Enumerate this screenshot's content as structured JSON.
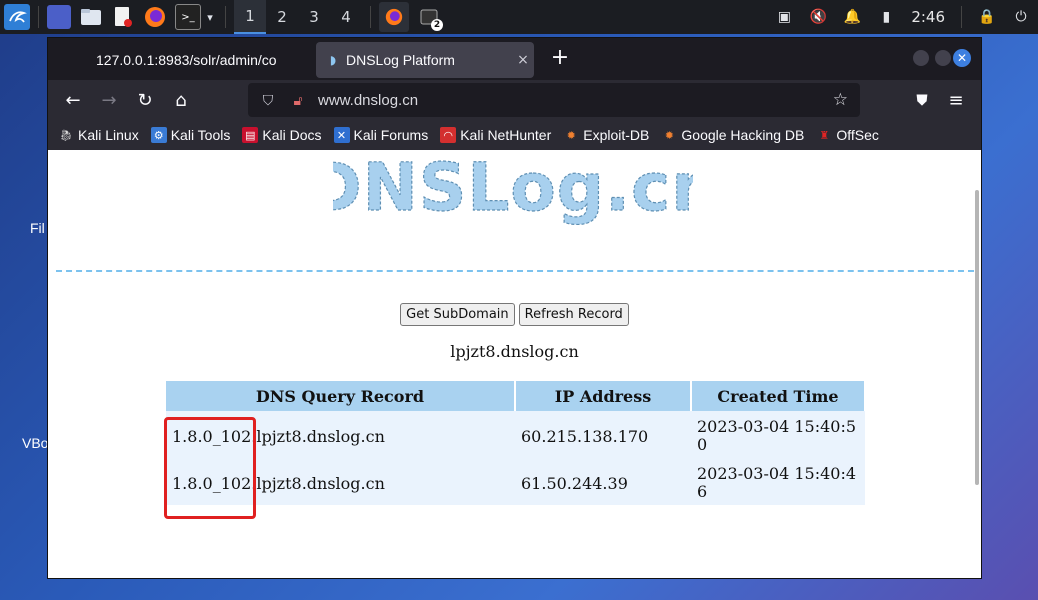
{
  "taskbar": {
    "workspaces": [
      "1",
      "2",
      "3",
      "4"
    ],
    "clock": "2:46",
    "terminal_badge": "2"
  },
  "desktop": {
    "labels": [
      "Fil",
      "VBo"
    ]
  },
  "browser": {
    "tabs": [
      {
        "title": "127.0.0.1:8983/solr/admin/co",
        "close": "×"
      },
      {
        "title": "DNSLog Platform",
        "close": "×"
      }
    ],
    "new_tab": "+",
    "url": "www.dnslog.cn",
    "bookmarks": [
      {
        "label": "Kali Linux",
        "icon": "kali-dragon-icon"
      },
      {
        "label": "Kali Tools",
        "icon": "kali-tools-icon"
      },
      {
        "label": "Kali Docs",
        "icon": "kali-docs-icon"
      },
      {
        "label": "Kali Forums",
        "icon": "kali-forums-icon"
      },
      {
        "label": "Kali NetHunter",
        "icon": "nethunter-icon"
      },
      {
        "label": "Exploit-DB",
        "icon": "exploitdb-icon"
      },
      {
        "label": "Google Hacking DB",
        "icon": "ghdb-icon"
      },
      {
        "label": "OffSec",
        "icon": "offsec-icon"
      }
    ]
  },
  "page": {
    "logo_text": "DNSLog.cn",
    "buttons": {
      "get_subdomain": "Get SubDomain",
      "refresh": "Refresh Record"
    },
    "subdomain": "lpjzt8.dnslog.cn",
    "table": {
      "headers": [
        "DNS Query Record",
        "IP Address",
        "Created Time"
      ],
      "rows": [
        [
          "1.8.0_102.lpjzt8.dnslog.cn",
          "60.215.138.170",
          "2023-03-04 15:40:50"
        ],
        [
          "1.8.0_102.lpjzt8.dnslog.cn",
          "61.50.244.39",
          "2023-03-04 15:40:46"
        ]
      ]
    }
  },
  "colors": {
    "accent": "#3d7fe0",
    "table_header": "#a9d2f0",
    "table_row": "#eaf3fd",
    "highlight": "#e02020",
    "logo": "#a8d0ee"
  }
}
